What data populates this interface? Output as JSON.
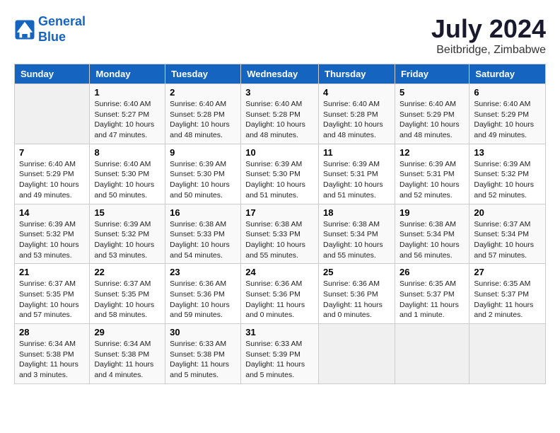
{
  "header": {
    "logo_line1": "General",
    "logo_line2": "Blue",
    "month_title": "July 2024",
    "location": "Beitbridge, Zimbabwe"
  },
  "days_of_week": [
    "Sunday",
    "Monday",
    "Tuesday",
    "Wednesday",
    "Thursday",
    "Friday",
    "Saturday"
  ],
  "weeks": [
    [
      {
        "day": "",
        "content": ""
      },
      {
        "day": "1",
        "content": "Sunrise: 6:40 AM\nSunset: 5:27 PM\nDaylight: 10 hours\nand 47 minutes."
      },
      {
        "day": "2",
        "content": "Sunrise: 6:40 AM\nSunset: 5:28 PM\nDaylight: 10 hours\nand 48 minutes."
      },
      {
        "day": "3",
        "content": "Sunrise: 6:40 AM\nSunset: 5:28 PM\nDaylight: 10 hours\nand 48 minutes."
      },
      {
        "day": "4",
        "content": "Sunrise: 6:40 AM\nSunset: 5:28 PM\nDaylight: 10 hours\nand 48 minutes."
      },
      {
        "day": "5",
        "content": "Sunrise: 6:40 AM\nSunset: 5:29 PM\nDaylight: 10 hours\nand 48 minutes."
      },
      {
        "day": "6",
        "content": "Sunrise: 6:40 AM\nSunset: 5:29 PM\nDaylight: 10 hours\nand 49 minutes."
      }
    ],
    [
      {
        "day": "7",
        "content": "Sunrise: 6:40 AM\nSunset: 5:29 PM\nDaylight: 10 hours\nand 49 minutes."
      },
      {
        "day": "8",
        "content": "Sunrise: 6:40 AM\nSunset: 5:30 PM\nDaylight: 10 hours\nand 50 minutes."
      },
      {
        "day": "9",
        "content": "Sunrise: 6:39 AM\nSunset: 5:30 PM\nDaylight: 10 hours\nand 50 minutes."
      },
      {
        "day": "10",
        "content": "Sunrise: 6:39 AM\nSunset: 5:30 PM\nDaylight: 10 hours\nand 51 minutes."
      },
      {
        "day": "11",
        "content": "Sunrise: 6:39 AM\nSunset: 5:31 PM\nDaylight: 10 hours\nand 51 minutes."
      },
      {
        "day": "12",
        "content": "Sunrise: 6:39 AM\nSunset: 5:31 PM\nDaylight: 10 hours\nand 52 minutes."
      },
      {
        "day": "13",
        "content": "Sunrise: 6:39 AM\nSunset: 5:32 PM\nDaylight: 10 hours\nand 52 minutes."
      }
    ],
    [
      {
        "day": "14",
        "content": "Sunrise: 6:39 AM\nSunset: 5:32 PM\nDaylight: 10 hours\nand 53 minutes."
      },
      {
        "day": "15",
        "content": "Sunrise: 6:39 AM\nSunset: 5:32 PM\nDaylight: 10 hours\nand 53 minutes."
      },
      {
        "day": "16",
        "content": "Sunrise: 6:38 AM\nSunset: 5:33 PM\nDaylight: 10 hours\nand 54 minutes."
      },
      {
        "day": "17",
        "content": "Sunrise: 6:38 AM\nSunset: 5:33 PM\nDaylight: 10 hours\nand 55 minutes."
      },
      {
        "day": "18",
        "content": "Sunrise: 6:38 AM\nSunset: 5:34 PM\nDaylight: 10 hours\nand 55 minutes."
      },
      {
        "day": "19",
        "content": "Sunrise: 6:38 AM\nSunset: 5:34 PM\nDaylight: 10 hours\nand 56 minutes."
      },
      {
        "day": "20",
        "content": "Sunrise: 6:37 AM\nSunset: 5:34 PM\nDaylight: 10 hours\nand 57 minutes."
      }
    ],
    [
      {
        "day": "21",
        "content": "Sunrise: 6:37 AM\nSunset: 5:35 PM\nDaylight: 10 hours\nand 57 minutes."
      },
      {
        "day": "22",
        "content": "Sunrise: 6:37 AM\nSunset: 5:35 PM\nDaylight: 10 hours\nand 58 minutes."
      },
      {
        "day": "23",
        "content": "Sunrise: 6:36 AM\nSunset: 5:36 PM\nDaylight: 10 hours\nand 59 minutes."
      },
      {
        "day": "24",
        "content": "Sunrise: 6:36 AM\nSunset: 5:36 PM\nDaylight: 11 hours\nand 0 minutes."
      },
      {
        "day": "25",
        "content": "Sunrise: 6:36 AM\nSunset: 5:36 PM\nDaylight: 11 hours\nand 0 minutes."
      },
      {
        "day": "26",
        "content": "Sunrise: 6:35 AM\nSunset: 5:37 PM\nDaylight: 11 hours\nand 1 minute."
      },
      {
        "day": "27",
        "content": "Sunrise: 6:35 AM\nSunset: 5:37 PM\nDaylight: 11 hours\nand 2 minutes."
      }
    ],
    [
      {
        "day": "28",
        "content": "Sunrise: 6:34 AM\nSunset: 5:38 PM\nDaylight: 11 hours\nand 3 minutes."
      },
      {
        "day": "29",
        "content": "Sunrise: 6:34 AM\nSunset: 5:38 PM\nDaylight: 11 hours\nand 4 minutes."
      },
      {
        "day": "30",
        "content": "Sunrise: 6:33 AM\nSunset: 5:38 PM\nDaylight: 11 hours\nand 5 minutes."
      },
      {
        "day": "31",
        "content": "Sunrise: 6:33 AM\nSunset: 5:39 PM\nDaylight: 11 hours\nand 5 minutes."
      },
      {
        "day": "",
        "content": ""
      },
      {
        "day": "",
        "content": ""
      },
      {
        "day": "",
        "content": ""
      }
    ]
  ]
}
